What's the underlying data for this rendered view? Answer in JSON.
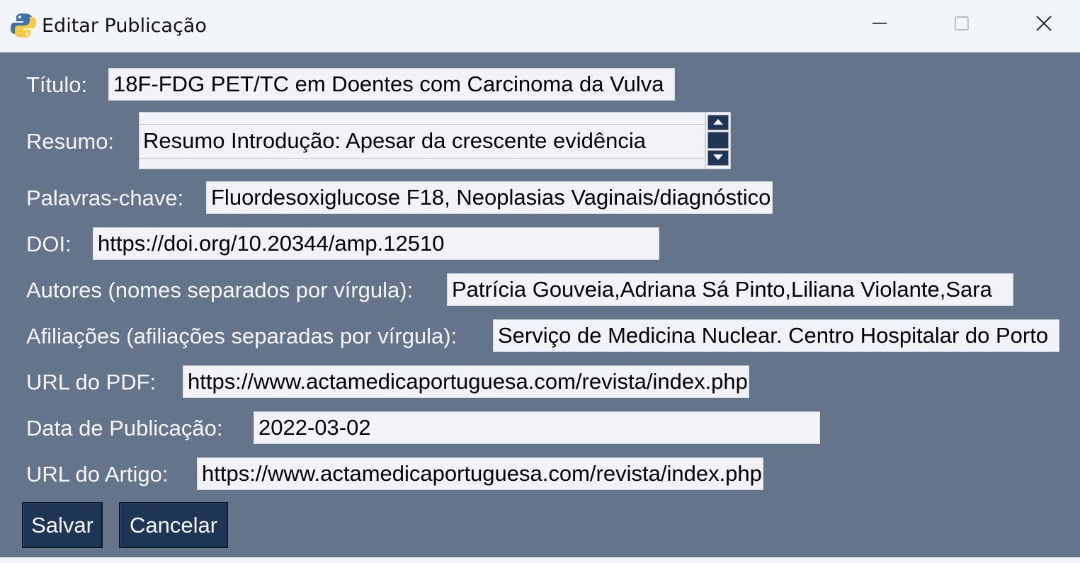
{
  "window": {
    "title": "Editar Publicação",
    "app_icon": "python-icon",
    "controls": {
      "minimize_icon": "minimize-icon",
      "maximize_icon": "maximize-icon",
      "close_icon": "close-icon"
    }
  },
  "form": {
    "titulo": {
      "label": "Título:",
      "value": "18F-FDG PET/TC em Doentes com Carcinoma da Vulva"
    },
    "resumo": {
      "label": "Resumo:",
      "value": "Resumo Introdução: Apesar da crescente evidência"
    },
    "palavras_chave": {
      "label": "Palavras-chave:",
      "value": "Fluordesoxiglucose F18, Neoplasias Vaginais/diagnóstico"
    },
    "doi": {
      "label": "DOI:",
      "value": "https://doi.org/10.20344/amp.12510"
    },
    "autores": {
      "label": "Autores (nomes separados por vírgula):",
      "value": "Patrícia Gouveia,Adriana Sá Pinto,Liliana Violante,Sara"
    },
    "afiliacoes": {
      "label": "Afiliações (afiliações separadas por vírgula):",
      "value": "Serviço de Medicina Nuclear. Centro Hospitalar do Porto"
    },
    "url_pdf": {
      "label": "URL do PDF:",
      "value": "https://www.actamedicaportuguesa.com/revista/index.php"
    },
    "data_publicacao": {
      "label": "Data de Publicação:",
      "value": "2022-03-02"
    },
    "url_artigo": {
      "label": "URL do Artigo:",
      "value": "https://www.actamedicaportuguesa.com/revista/index.php"
    }
  },
  "buttons": {
    "save": "Salvar",
    "cancel": "Cancelar"
  },
  "colors": {
    "background": "#64748a",
    "titlebar": "#f2f5fa",
    "button_bg": "#1f3556",
    "field_bg": "#f1f3f8"
  }
}
